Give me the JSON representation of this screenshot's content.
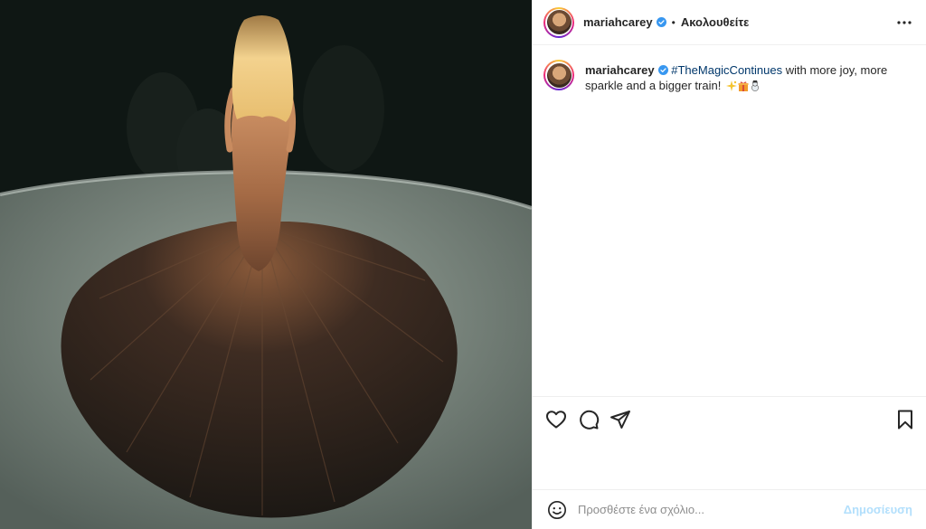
{
  "post": {
    "image_description_icon": "photo",
    "header": {
      "username": "mariahcarey",
      "verified": true,
      "separator": "•",
      "follow_state": "Ακολουθείτε",
      "more_icon": "more-horizontal-icon"
    },
    "caption": {
      "username": "mariahcarey",
      "hashtag": "#TheMagicContinues",
      "text": " with more joy, more sparkle and a bigger train!",
      "emojis": [
        "sparkles-icon",
        "gift-icon",
        "snowman-icon"
      ]
    },
    "actions": {
      "like_icon": "heart-icon",
      "comment_icon": "comment-icon",
      "share_icon": "send-icon",
      "save_icon": "bookmark-icon"
    },
    "comment_bar": {
      "emoji_icon": "smiley-icon",
      "placeholder": "Προσθέστε ένα σχόλιο...",
      "post_label": "Δημοσίευση"
    },
    "colors": {
      "verified": "#3897f0",
      "hashtag": "#00376b",
      "post_button_disabled": "#b2dffc",
      "border": "#efefef"
    }
  }
}
